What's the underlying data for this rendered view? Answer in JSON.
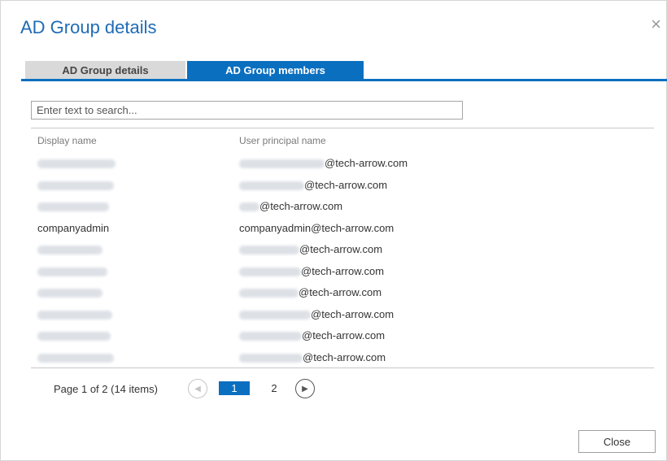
{
  "dialog": {
    "title": "AD Group details",
    "close_glyph": "×",
    "close_icon": "close-icon"
  },
  "tabs": [
    {
      "label": "AD Group details",
      "active": false
    },
    {
      "label": "AD Group members",
      "active": true
    }
  ],
  "search": {
    "value": "",
    "placeholder": "Enter text to search..."
  },
  "table": {
    "columns": [
      "Display name",
      "User principal name"
    ],
    "rows": [
      {
        "display_name": "",
        "upn": "@tech-arrow.com",
        "redacted": true
      },
      {
        "display_name": "",
        "upn": "@tech-arrow.com",
        "redacted": true
      },
      {
        "display_name": "",
        "upn": "@tech-arrow.com",
        "redacted": true
      },
      {
        "display_name": "companyadmin",
        "upn": "companyadmin@tech-arrow.com",
        "redacted": false
      },
      {
        "display_name": "",
        "upn": "@tech-arrow.com",
        "redacted": true
      },
      {
        "display_name": "",
        "upn": "@tech-arrow.com",
        "redacted": true
      },
      {
        "display_name": "",
        "upn": "@tech-arrow.com",
        "redacted": true
      },
      {
        "display_name": "",
        "upn": "@tech-arrow.com",
        "redacted": true
      },
      {
        "display_name": "",
        "upn": "@tech-arrow.com",
        "redacted": true
      },
      {
        "display_name": "",
        "upn": "@tech-arrow.com",
        "redacted": true
      }
    ]
  },
  "pager": {
    "info": "Page 1 of 2 (14 items)",
    "current_page": "1",
    "other_page": "2",
    "prev_glyph": "◀",
    "next_glyph": "▶"
  },
  "footer": {
    "close_label": "Close"
  },
  "colors": {
    "accent": "#0b6fc0",
    "title": "#1f6bb5"
  }
}
